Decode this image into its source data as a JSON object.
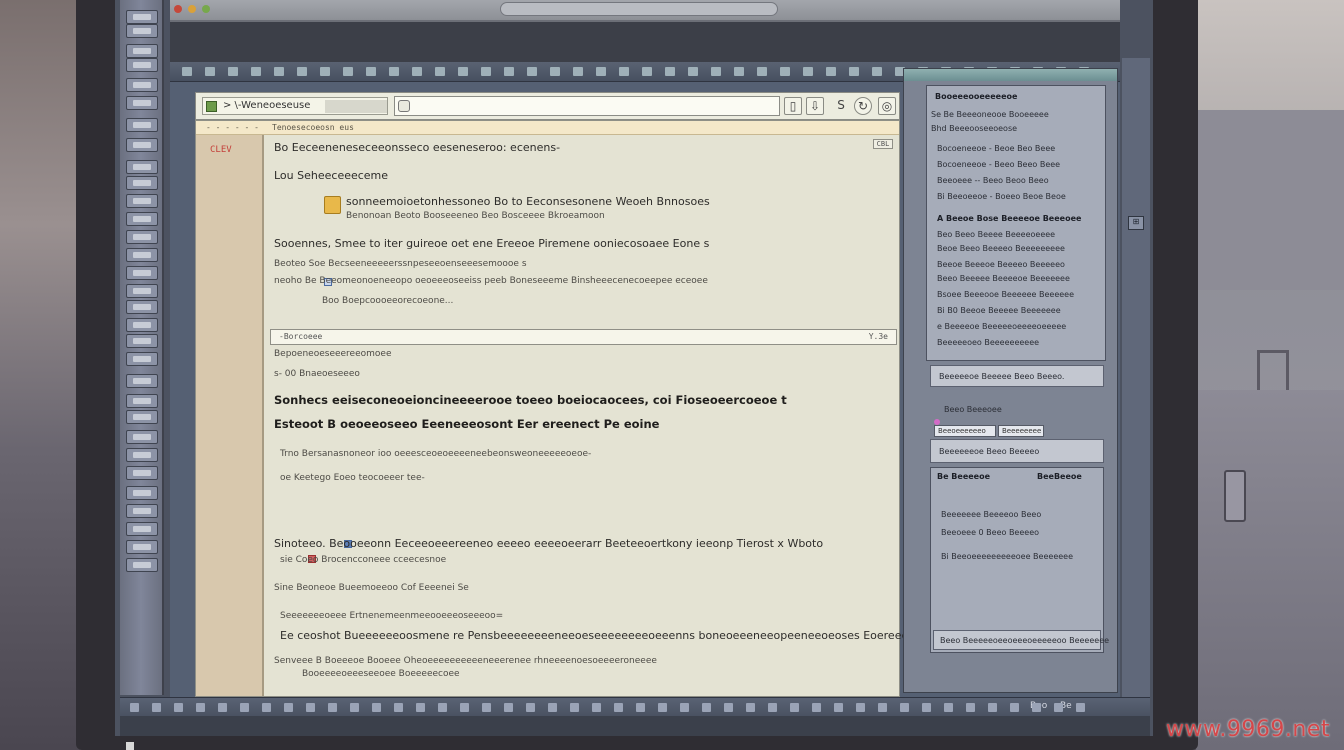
{
  "document": {
    "tab_title": "> \\-Weneoeseuse",
    "gutter_header": "- - - - - -",
    "gutter_mark": "CLEV",
    "header_strip": "Tenoesecoeosn eus",
    "corner_label": "CBL",
    "lines": [
      "Bo  Eeceeneneseceeonsseco eeseneseroo: ecenens-",
      "Lou  Seheeceeeceme",
      "sonneemoioetonhessoneo  Bo  to  Eeconsesonene  Weoeh  Bnnosoes",
      "Benonoan  Beoto  Booseeeneo  Beo  Bosceeee  Bkroeamoon",
      "Sooennes,  Smee  to  iter  guireoe  oet  ene  Ereeoe  Piremene  ooniecosoaee  Eone  s",
      "Beoteo    Soe  Becseeneeeeerssnpeseeoenseeesemoooe  s",
      "neoho    Be  Beeomeonoeneeopo  oeoeeeoseeiss  peeb  Boneseeeme  Binsheeecenecoeepee  eceoee",
      "Boo  Boepcoooeeorecoeone..."
    ],
    "separator_left": "-Borcoeee",
    "separator_right": "Y.3e",
    "lines2": [
      "Bepoeneoeseeereeomoee",
      "s- 00  Bnaeoeseeeo",
      "Sonhecs  eeiseconeoeioncineeeerooe  toeeo  boeiocaocees, coi  Fioseoeercoeoe  t",
      "Esteoot  B  oeoeeoseeo  Eeeneeeosont  Eer  ereenect  Pe  eoine",
      "Trno  Bersanasnoneor  ioo  oeeesceoeoeeeeneebeonsweoneeeeeoeoe-",
      "oe  Keetego  Eoeo  teocoeeer  tee-",
      "Sinoteeo.    Beooeeonn  Eeceeoeeereeneo  eeeeo  eeeeoeerarr  Beeteeoertkony  ieeonp  Tierost  x  Wboto",
      "sie  Coeo  Brocencconeee  cceecesnoe",
      "Sine  Beoneoe  Bueemoeeoo  Cof  Eeeenei  Se",
      "Seeeeeeeoeee  Ertnenemeenmeeooeeeoseeeoo=",
      "Ee  ceoshot  Bueeeeeeoosmene  re  Pensbeeeeeeeeneeoeseeeeeeeeoeeenns  boneoeeeneeopeeneeoeoses  Eoereeen.",
      "Senveee  B  Boeeeoe  Booeee  Oheoeeeeeeeeeeneeerenee  rhneeeenoesoeeeeroneeee",
      "Booeeeeoeeeseeoee  Boeeeeecoee"
    ]
  },
  "right_panel": {
    "title": "Booeeeooeeeeeoe",
    "header2": "Se  Be  Beeeoneooe  Booeeeee",
    "header3": "Bhd  Beeeooseeoeose",
    "rows": [
      "Bocoeneeoe  -  Beoe  Beo  Beee",
      "Bocoeneeoe  -  Beeo  Beeo  Beee",
      "Beeoeee  --  Beeo  Beoo  Beeo",
      "Bi  Beeoeeoe  -  Boeeo  Beoe  Beoe"
    ],
    "section2_head": "A  Beeoe  Bose  Beeeeoe  Beeeoee",
    "rows2": [
      "Beo  Beeo  Beeee  Beeeeoeeee",
      "Beoe  Beeo  Beeeeo  Beeeeeeeee",
      "Beeoe  Beeeoe  Beeeeo  Beeeeeo",
      "Beeo  Beeeee  Beeeeoe  Beeeeeee",
      "Bsoee  Beeeooe  Beeeeee  Beeeeee",
      "Bi  B0  Beeoe  Beeeee  Beeeeeee",
      "e  Beeeeoe  Beeeeeoeeeeoeeeee",
      "Beeeeeoeo  Beeeeeeeeee"
    ],
    "bar1": "Beeeeeoe   Beeeee   Beeo  Beeeo.",
    "label_small": "Beeo  Beeeoee",
    "input1": "Beeoeeeeeeo",
    "input2": "Beeeeeeee",
    "bar2": "Beeeeeeoe   Beeo  Beeeeo",
    "lower_head": "Be  Beeeeoe",
    "lower_right": "BeeBeeoe",
    "rows3": [
      "Beeeeeee  Beeeeoo  Beeo",
      "Beeoeee  0  Beeo  Beeeeo",
      "Bi  Beeoeeeeeeeeeoee  Beeeeeee"
    ],
    "footer": "Beeo  Beeeeeoeeoeeeoeeeeeoo  Beeeeeee"
  },
  "bottom_bar": {
    "labels": [
      "Beo",
      "Be"
    ]
  },
  "watermark": "www.9969.net"
}
